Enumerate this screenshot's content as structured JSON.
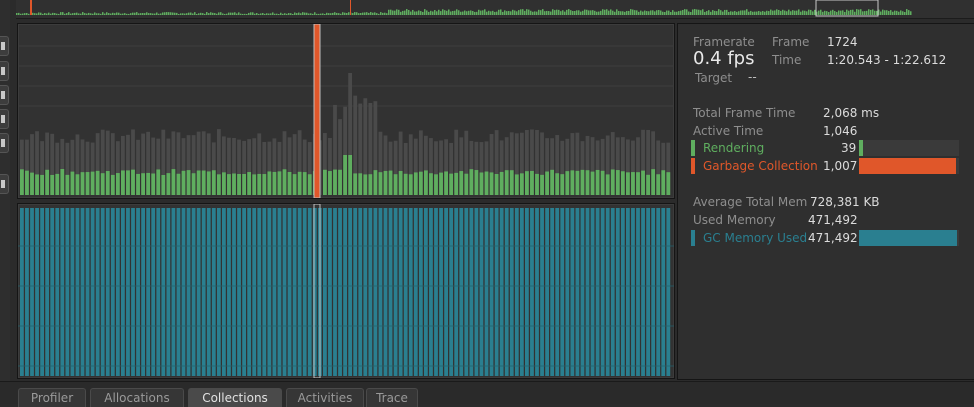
{
  "stats": {
    "framerate_label": "Framerate",
    "fps_value": "0.4 fps",
    "target_label": "Target",
    "target_value": "--",
    "frame_label": "Frame",
    "frame_value": "1724",
    "time_label": "Time",
    "time_value": "1:20.543 - 1:22.612",
    "total_frame_time_label": "Total Frame Time",
    "total_frame_time_value": "2,068 ms",
    "active_time_label": "Active Time",
    "active_time_value": "1,046",
    "rendering_label": "Rendering",
    "rendering_value": "39",
    "gc_label": "Garbage Collection",
    "gc_value": "1,007",
    "avg_total_mem_label": "Average Total Mem",
    "avg_total_mem_value": "728,381 KB",
    "used_memory_label": "Used Memory",
    "used_memory_value": "471,492",
    "gc_memory_label": "GC Memory Used",
    "gc_memory_value": "471,492",
    "rendering_fraction": 0.037,
    "gc_fraction": 0.974,
    "gc_memory_fraction": 0.98
  },
  "colors": {
    "rendering": "#5fae5f",
    "gc": "#e0572a",
    "gc_memory": "#2a7f90",
    "grey_bar": "#4a4a4a"
  },
  "tabs": [
    {
      "label": "Profiler"
    },
    {
      "label": "Allocations"
    },
    {
      "label": "Collections"
    },
    {
      "label": "Activities"
    },
    {
      "label": "Trace"
    }
  ],
  "active_tab": "Collections"
}
